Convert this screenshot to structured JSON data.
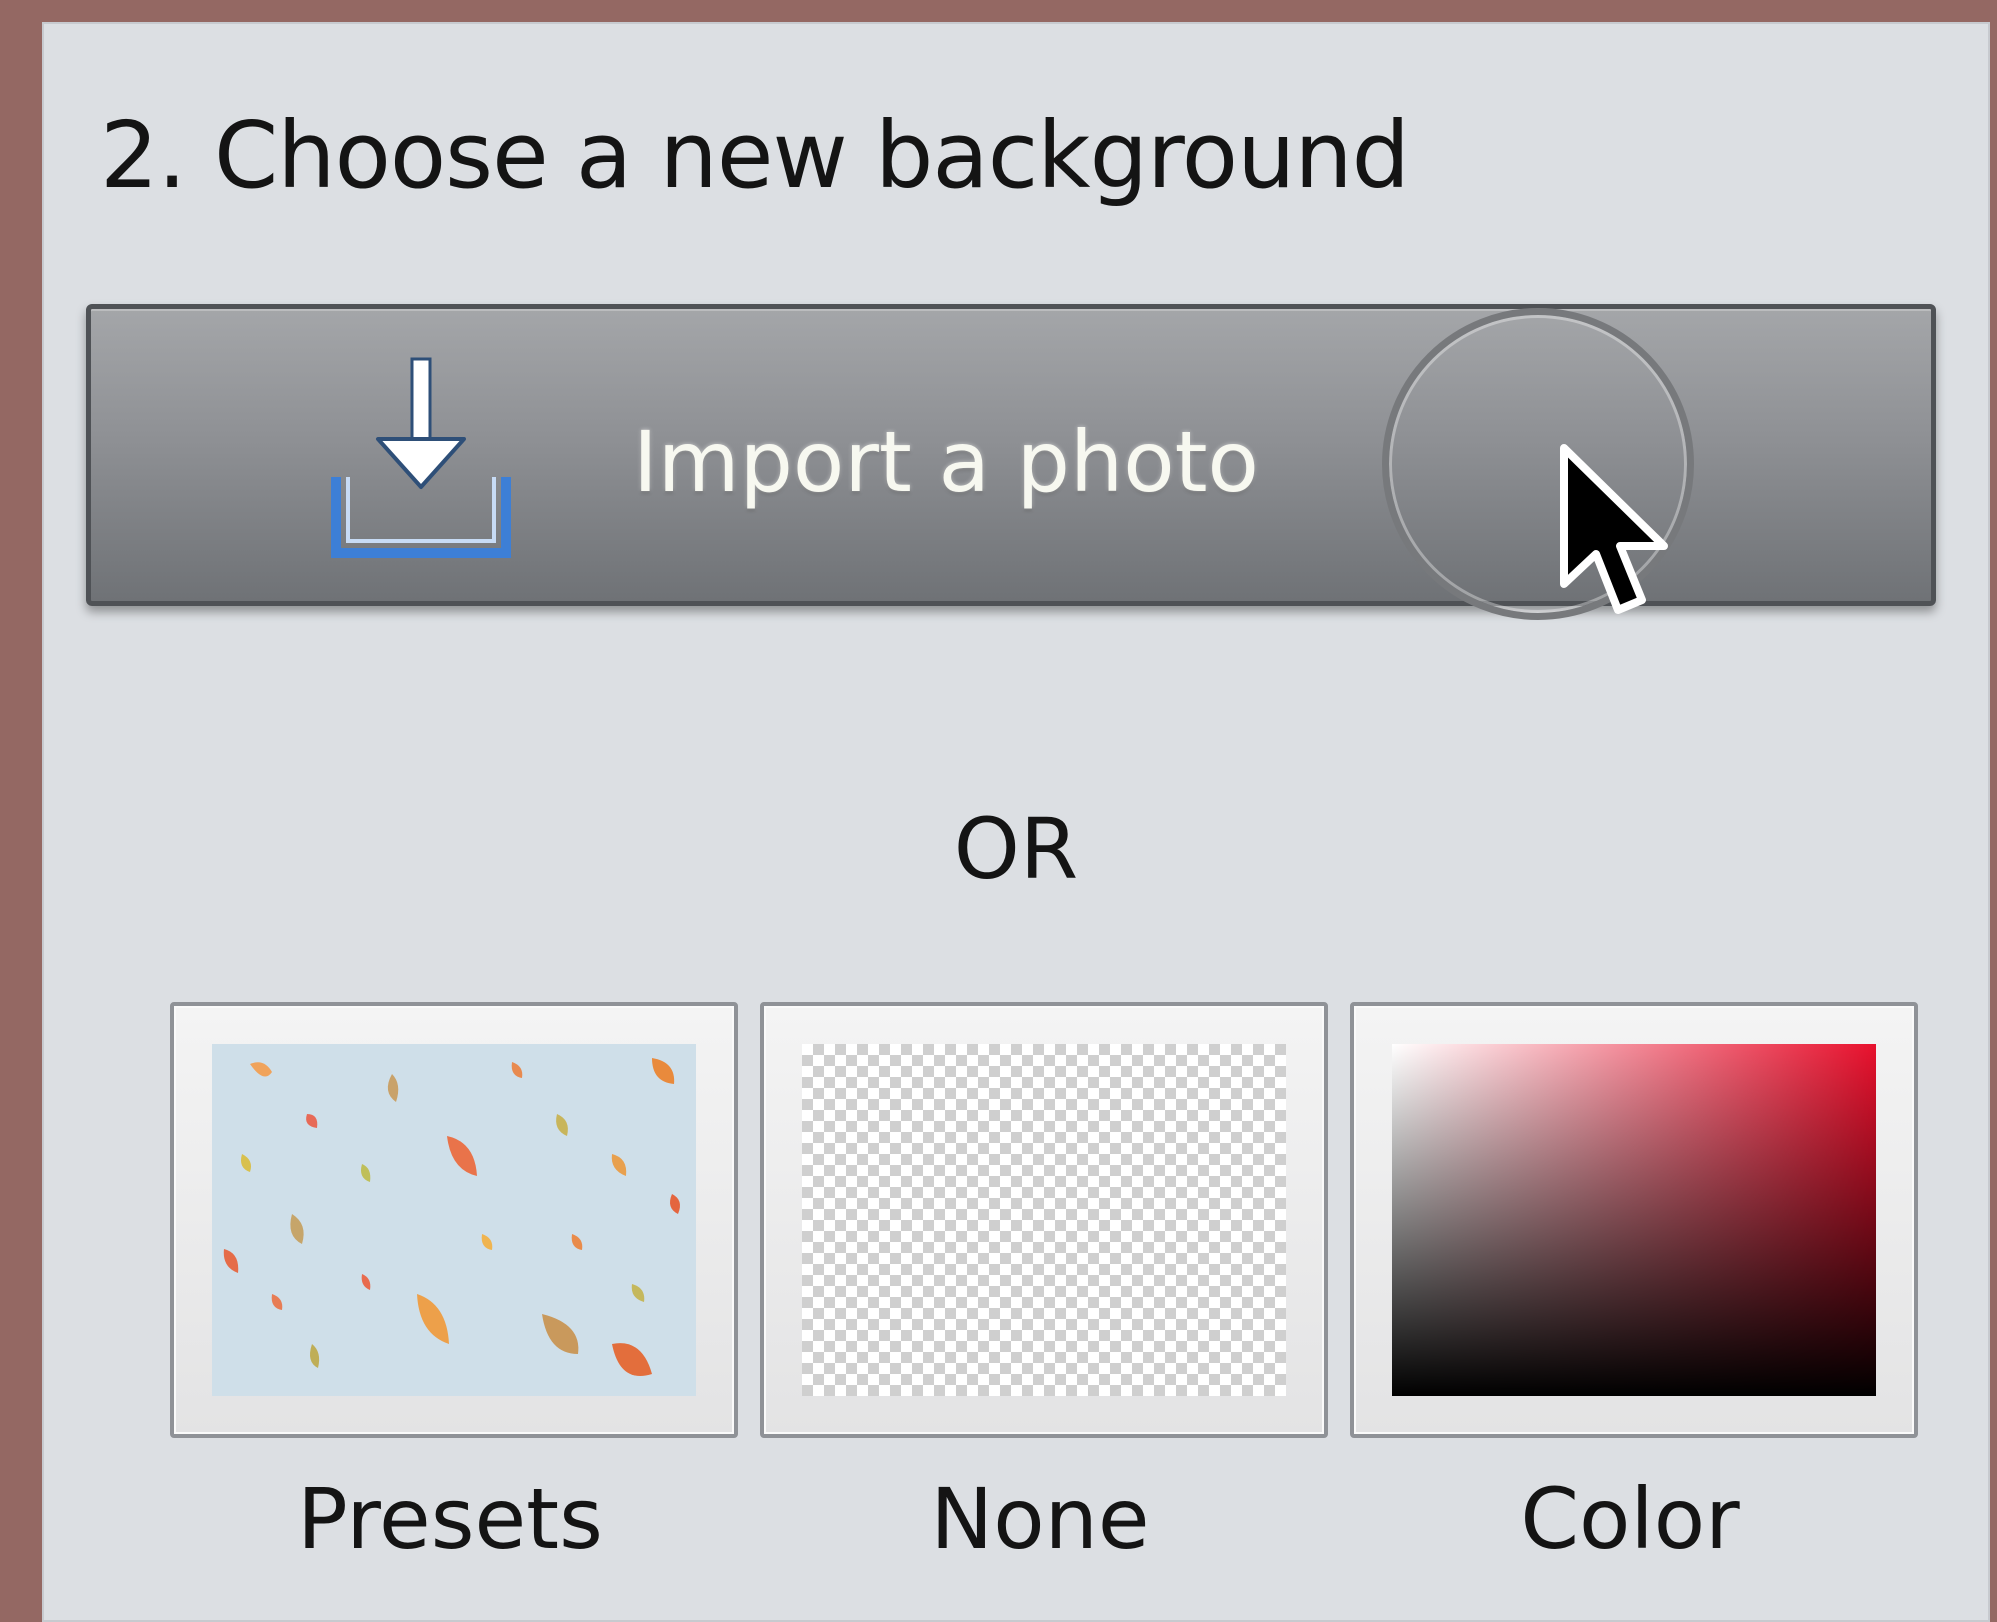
{
  "panel": {
    "heading": "2. Choose a new background"
  },
  "import": {
    "label": "Import a photo",
    "icon": "import-icon"
  },
  "separator": {
    "text": "OR"
  },
  "options": [
    {
      "label": "Presets",
      "icon": "presets-pattern-icon"
    },
    {
      "label": "None",
      "icon": "transparent-checkerboard-icon"
    },
    {
      "label": "Color",
      "icon": "color-gradient-icon",
      "color": "#e8112d"
    }
  ],
  "colors": {
    "window_border": "#946863",
    "panel_bg": "#dcdfe3",
    "import_icon_accent": "#3d7fd6"
  }
}
